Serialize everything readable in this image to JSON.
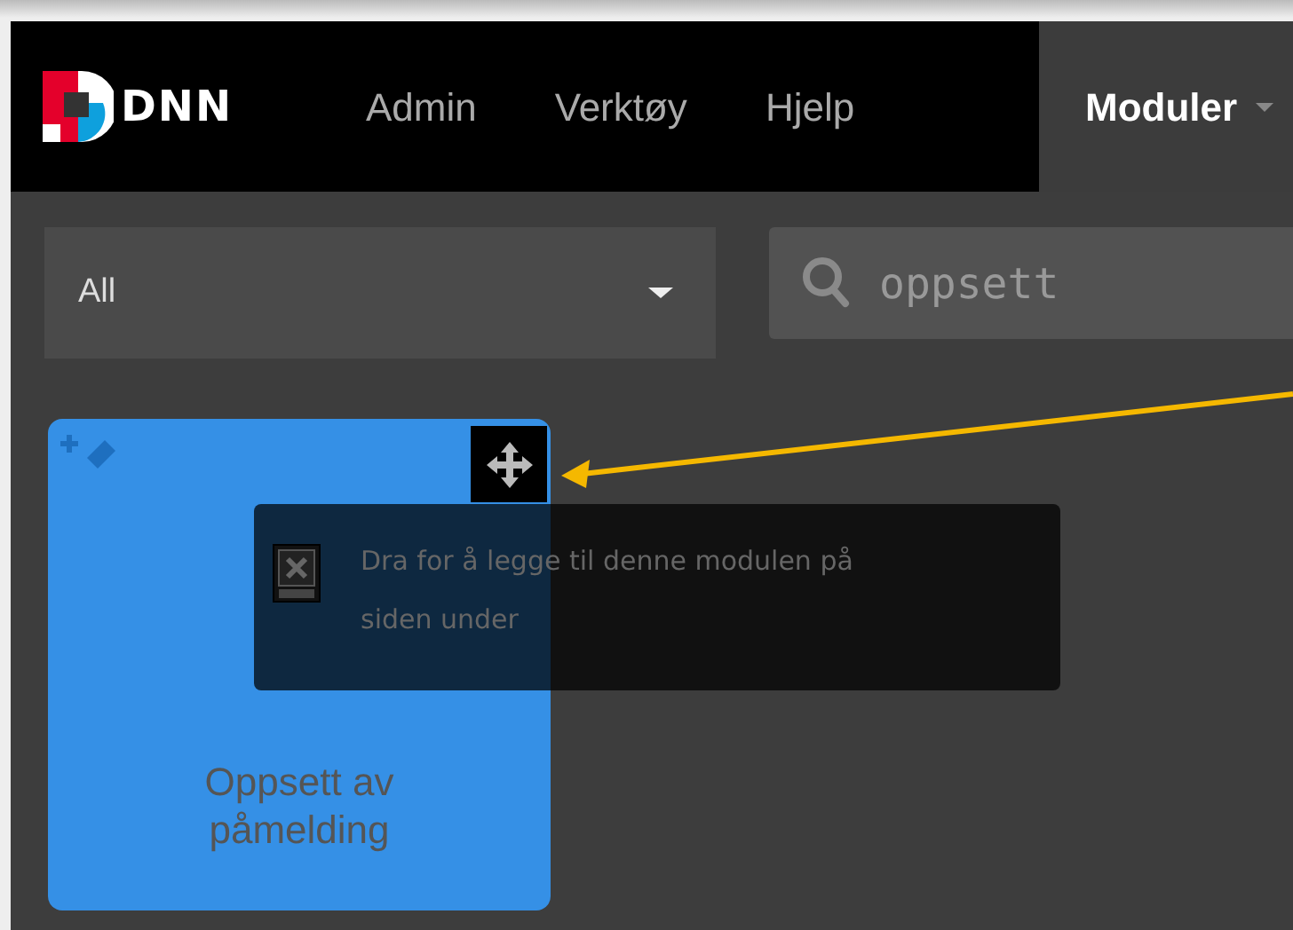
{
  "navbar": {
    "logo_text": "DNN",
    "menu": [
      {
        "label": "Admin",
        "selected": false
      },
      {
        "label": "Verktøy",
        "selected": false
      },
      {
        "label": "Hjelp",
        "selected": false
      },
      {
        "label": "Moduler",
        "selected": true
      }
    ]
  },
  "filter": {
    "value": "All"
  },
  "search": {
    "value": "oppsett"
  },
  "modules": [
    {
      "title": "Oppsett av påmelding"
    }
  ],
  "tooltip": {
    "text": "Dra for å legge til denne modulen på siden under"
  }
}
